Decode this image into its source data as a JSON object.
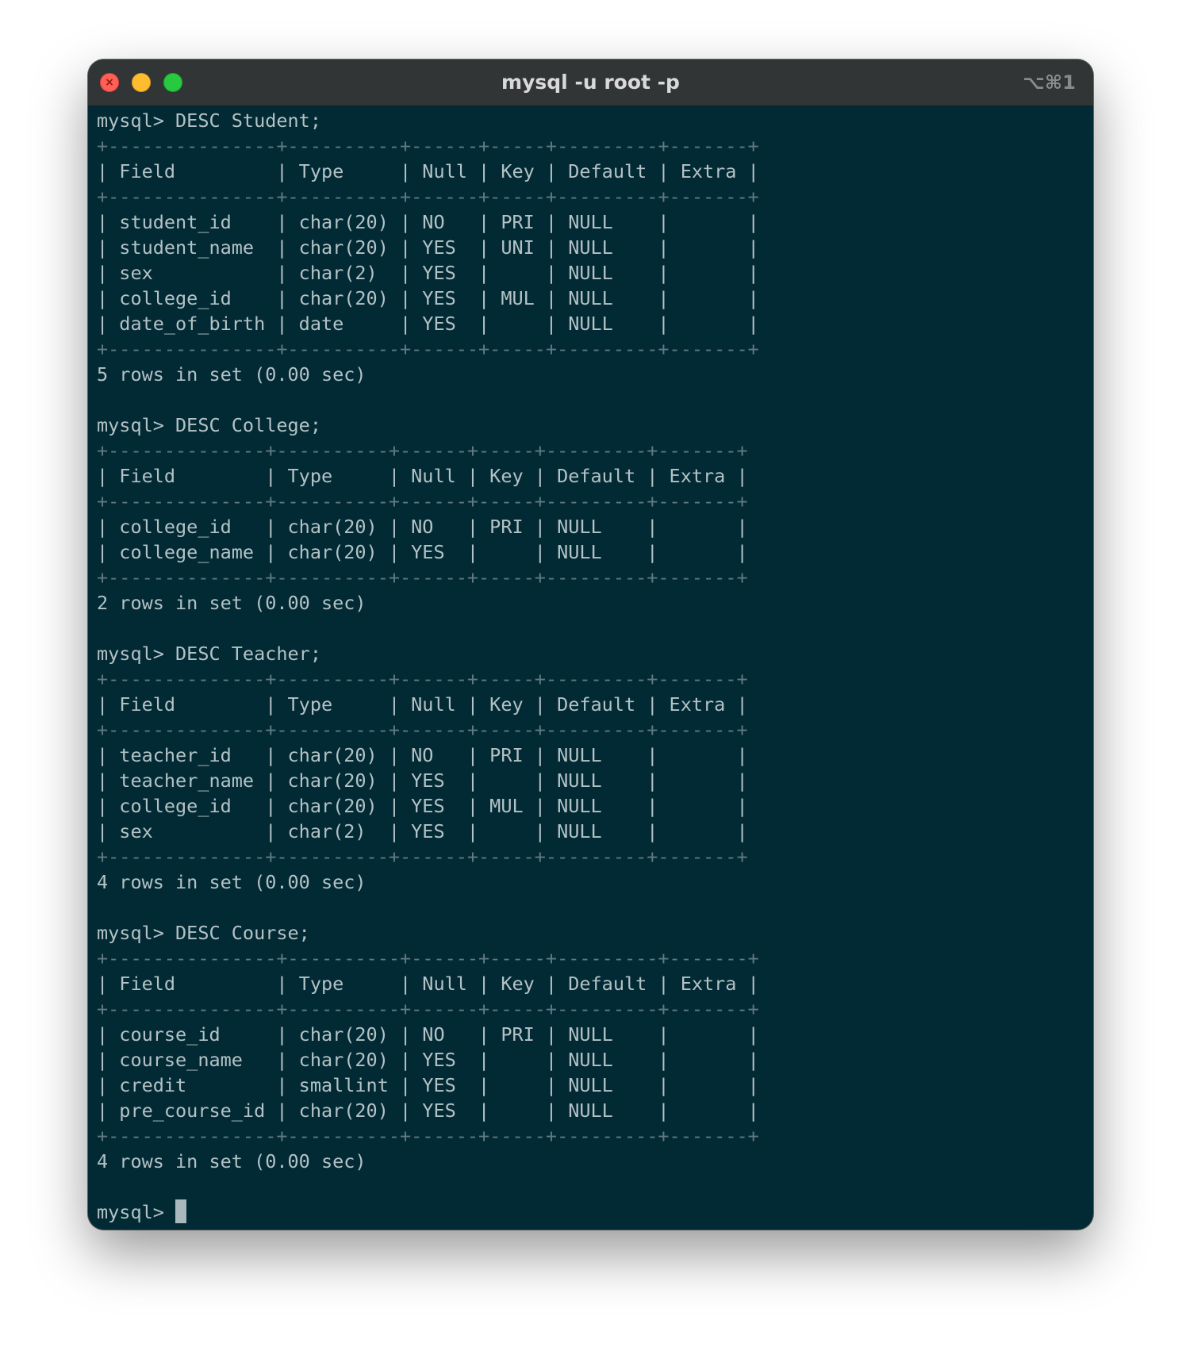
{
  "window": {
    "title": "mysql -u root -p",
    "shortcut": "⌥⌘1",
    "close_glyph": "×"
  },
  "terminal": {
    "lines": [
      "mysql> DESC Student;",
      "+---------------+----------+------+-----+---------+-------+",
      "| Field         | Type     | Null | Key | Default | Extra |",
      "+---------------+----------+------+-----+---------+-------+",
      "| student_id    | char(20) | NO   | PRI | NULL    |       |",
      "| student_name  | char(20) | YES  | UNI | NULL    |       |",
      "| sex           | char(2)  | YES  |     | NULL    |       |",
      "| college_id    | char(20) | YES  | MUL | NULL    |       |",
      "| date_of_birth | date     | YES  |     | NULL    |       |",
      "+---------------+----------+------+-----+---------+-------+",
      "5 rows in set (0.00 sec)",
      "",
      "mysql> DESC College;",
      "+--------------+----------+------+-----+---------+-------+",
      "| Field        | Type     | Null | Key | Default | Extra |",
      "+--------------+----------+------+-----+---------+-------+",
      "| college_id   | char(20) | NO   | PRI | NULL    |       |",
      "| college_name | char(20) | YES  |     | NULL    |       |",
      "+--------------+----------+------+-----+---------+-------+",
      "2 rows in set (0.00 sec)",
      "",
      "mysql> DESC Teacher;",
      "+--------------+----------+------+-----+---------+-------+",
      "| Field        | Type     | Null | Key | Default | Extra |",
      "+--------------+----------+------+-----+---------+-------+",
      "| teacher_id   | char(20) | NO   | PRI | NULL    |       |",
      "| teacher_name | char(20) | YES  |     | NULL    |       |",
      "| college_id   | char(20) | YES  | MUL | NULL    |       |",
      "| sex          | char(2)  | YES  |     | NULL    |       |",
      "+--------------+----------+------+-----+---------+-------+",
      "4 rows in set (0.00 sec)",
      "",
      "mysql> DESC Course;",
      "+---------------+----------+------+-----+---------+-------+",
      "| Field         | Type     | Null | Key | Default | Extra |",
      "+---------------+----------+------+-----+---------+-------+",
      "| course_id     | char(20) | NO   | PRI | NULL    |       |",
      "| course_name   | char(20) | YES  |     | NULL    |       |",
      "| credit        | smallint | YES  |     | NULL    |       |",
      "| pre_course_id | char(20) | YES  |     | NULL    |       |",
      "+---------------+----------+------+-----+---------+-------+",
      "4 rows in set (0.00 sec)",
      ""
    ],
    "prompt": "mysql> "
  }
}
